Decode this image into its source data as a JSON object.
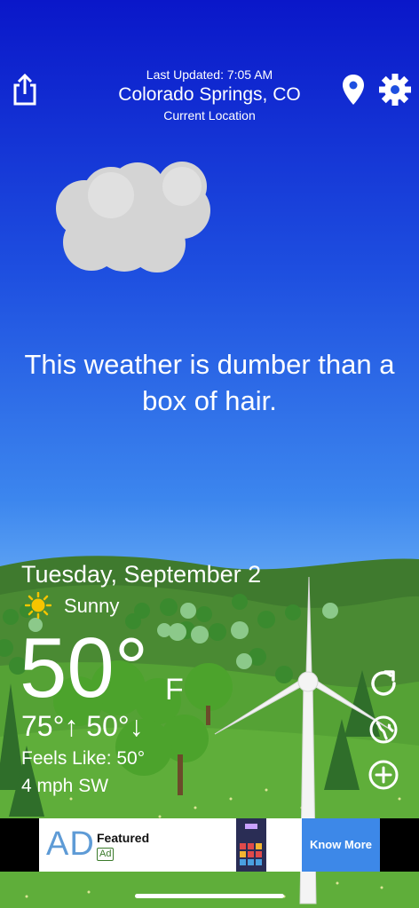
{
  "header": {
    "last_updated": "Last Updated: 7:05 AM",
    "city": "Colorado Springs, CO",
    "location_label": "Current Location"
  },
  "message": "This weather is dumber than a box of hair.",
  "weather": {
    "date": "Tuesday, September 2",
    "condition": "Sunny",
    "temperature": "50°",
    "unit": "F",
    "high": "75°",
    "low": "50°",
    "feels_like": "Feels Like: 50°",
    "wind": "4 mph SW"
  },
  "icons": {
    "share": "share-icon",
    "location": "location-pin-icon",
    "settings": "gear-icon",
    "sun": "sun-icon",
    "refresh": "refresh-icon",
    "globe": "globe-icon",
    "add": "add-circle-icon"
  },
  "ad": {
    "logo": "AD",
    "title": "Featured",
    "badge": "Ad",
    "cta": "Know More"
  },
  "colors": {
    "sky_top": "#0a17c9",
    "sky_bottom": "#8cc3f7",
    "grass": "#4f9a2e",
    "ad_cta": "#3d88e8"
  }
}
